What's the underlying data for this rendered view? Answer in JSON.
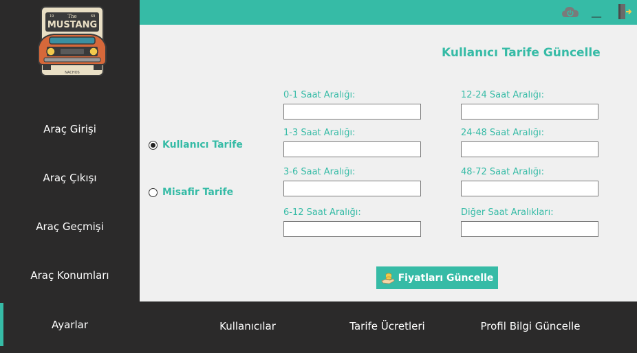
{
  "sidebar": {
    "logo": {
      "top": "The",
      "main": "MUSTANG",
      "year_left": "19",
      "year_right": "69",
      "bottom": "NACHOS"
    },
    "items": [
      {
        "label": "Araç Girişi"
      },
      {
        "label": "Araç Çıkışı"
      },
      {
        "label": "Araç Geçmişi"
      },
      {
        "label": "Araç Konumları"
      },
      {
        "label": "Ayarlar",
        "active": true
      }
    ]
  },
  "topbar": {
    "icons": [
      "cloud-power-icon",
      "minimize-icon",
      "exit-door-icon"
    ],
    "minimize_glyph": "__",
    "accent": "#36bba6"
  },
  "form": {
    "title": "Kullanıcı Tarife Güncelle",
    "tariff_options": [
      {
        "label": "Kullanıcı Tarife",
        "selected": true
      },
      {
        "label": "Misafir Tarife",
        "selected": false
      }
    ],
    "fields_left": [
      {
        "label": "0-1 Saat Aralığı:",
        "value": ""
      },
      {
        "label": "1-3 Saat Aralığı:",
        "value": ""
      },
      {
        "label": "3-6 Saat Aralığı:",
        "value": ""
      },
      {
        "label": "6-12 Saat Aralığı:",
        "value": ""
      }
    ],
    "fields_right": [
      {
        "label": "12-24 Saat Aralığı:",
        "value": ""
      },
      {
        "label": "24-48 Saat Aralığı:",
        "value": ""
      },
      {
        "label": "48-72 Saat Aralığı:",
        "value": ""
      },
      {
        "label": "Diğer Saat Aralıkları:",
        "value": ""
      }
    ],
    "update_button": "Fiyatları Güncelle"
  },
  "bottombar": {
    "items": [
      {
        "label": "Kullanıcılar"
      },
      {
        "label": "Tarife Ücretleri"
      },
      {
        "label": "Profil Bilgi Güncelle"
      }
    ]
  },
  "colors": {
    "accent": "#36bba6",
    "dark": "#2b2a2a",
    "panel": "#f0f0f0"
  }
}
